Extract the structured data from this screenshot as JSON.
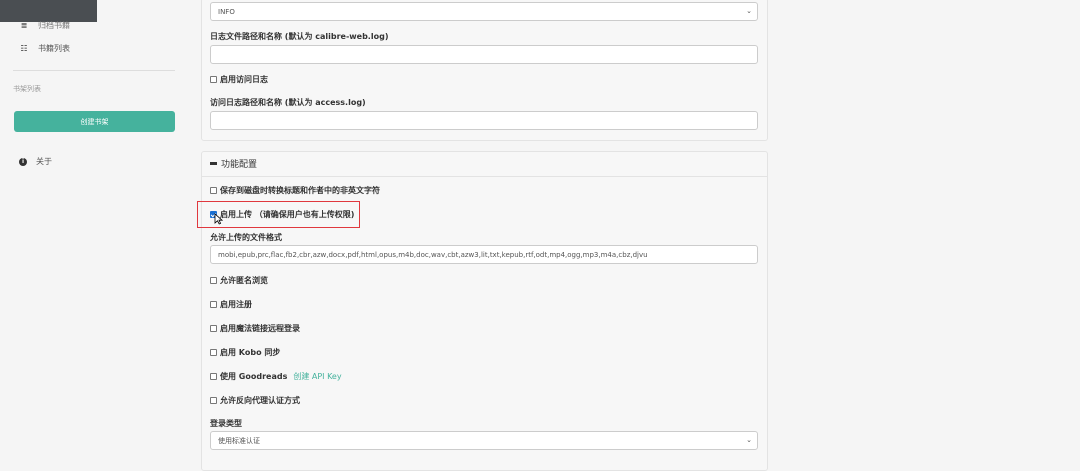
{
  "sidebar": {
    "items": [
      {
        "label": "归档书籍",
        "icon": "archive-icon"
      },
      {
        "label": "书籍列表",
        "icon": "list-icon"
      }
    ],
    "shelves_heading": "书架列表",
    "create_shelf_label": "创建书架",
    "about_label": "关于",
    "about_icon": "info-icon"
  },
  "logging": {
    "level_value": "INFO",
    "logfile_label": "日志文件路径和名称 (默认为 calibre-web.log)",
    "logfile_value": "",
    "enable_access_log_label": "启用访问日志",
    "enable_access_log_checked": false,
    "access_log_label": "访问日志路径和名称 (默认为 access.log)",
    "access_log_value": ""
  },
  "features": {
    "section_title": "功能配置",
    "options": [
      {
        "label": "保存到磁盘时转换标题和作者中的非英文字符",
        "checked": false
      },
      {
        "label": "启用上传 （请确保用户也有上传权限)",
        "checked": true
      },
      {
        "label": "允许匿名浏览",
        "checked": false
      },
      {
        "label": "启用注册",
        "checked": false
      },
      {
        "label": "启用魔法链接远程登录",
        "checked": false
      },
      {
        "label": "启用 Kobo 同步",
        "checked": false
      },
      {
        "label": "使用 Goodreads",
        "checked": false,
        "link": "创建 API Key"
      },
      {
        "label": "允许反向代理认证方式",
        "checked": false
      }
    ],
    "upload_formats_label": "允许上传的文件格式",
    "upload_formats_value": "mobi,epub,prc,flac,fb2,cbr,azw,docx,pdf,html,opus,m4b,doc,wav,cbt,azw3,lit,txt,kepub,rtf,odt,mp4,ogg,mp3,m4a,cbz,djvu",
    "login_type_label": "登录类型",
    "login_type_value": "使用标准认证"
  },
  "colors": {
    "accent": "#45b29d",
    "highlight": "#e0383e",
    "checkbox": "#1a6fd1"
  }
}
